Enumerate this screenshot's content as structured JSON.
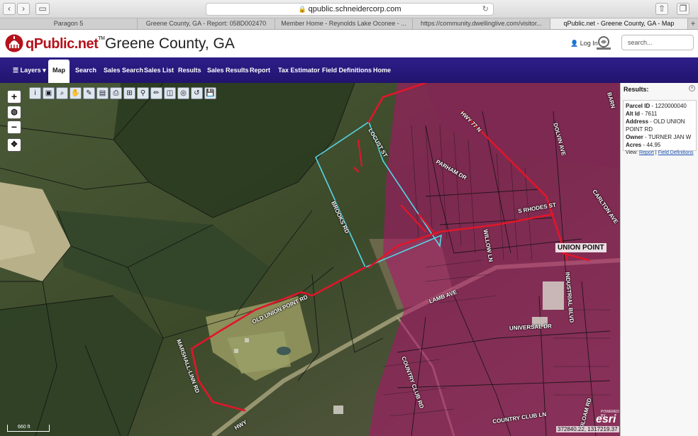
{
  "browser": {
    "url": "qpublic.schneidercorp.com",
    "tabs": [
      {
        "label": "Paragon 5",
        "active": false
      },
      {
        "label": "Greene County, GA - Report: 058D002470",
        "active": false
      },
      {
        "label": "Member Home - Reynolds Lake Oconee - ...",
        "active": false
      },
      {
        "label": "https://community.dwellinglive.com/visitor...",
        "active": false
      },
      {
        "label": "qPublic.net - Greene County, GA - Map",
        "active": true
      }
    ]
  },
  "header": {
    "logo": "qPublic.net",
    "logo_tm": "TM",
    "county": "Greene County, GA",
    "login": "Log In",
    "search_placeholder": "search..."
  },
  "nav": {
    "layers": "Layers",
    "map": "Map",
    "search": "Search",
    "sales_search": "Sales Search",
    "sales_list": "Sales List",
    "results": "Results",
    "sales_results": "Sales Results",
    "report": "Report",
    "tax_estimator": "Tax Estimator",
    "field_definitions": "Field Definitions",
    "home": "Home"
  },
  "map": {
    "scale": "660 ft",
    "coordinates": "372840.22, 1317219.37",
    "esri_powered": "POWERED BY",
    "esri": "esri",
    "city_label": "UNION POINT",
    "roads": {
      "hwy77": "HWY 77 N",
      "dolvin": "DOLVIN AVE",
      "carlton": "CARLTON AVE",
      "rhodes": "S RHODES ST",
      "parham": "PARHAM DR",
      "willow": "WILLOW LN",
      "lamb": "LAMB AVE",
      "universal": "UNIVERSAL DR",
      "industrial": "INDUSTRIAL BLVD",
      "country_club_rd": "COUNTRY CLUB RD",
      "country_club_ln": "COUNTRY CLUB LN",
      "siloam": "SILOAM RD",
      "old_union": "OLD UNION POINT RD",
      "marshall": "MARSHALL-LINN RD",
      "locust": "LOCUST ST",
      "brooks": "BROOKS RD",
      "barn": "BARN",
      "hwy": "HWY"
    }
  },
  "results": {
    "title": "Results:",
    "parcel_id_label": "Parcel ID",
    "parcel_id": "1220000040",
    "alt_id_label": "Alt Id",
    "alt_id": "7611",
    "address_label": "Address",
    "address": "OLD UNION POINT RD",
    "owner_label": "Owner",
    "owner": "TURNER JAN W",
    "acres_label": "Acres",
    "acres": "44.95",
    "view_label": "View:",
    "report_link": "Report",
    "field_definitions_link": "Field Definitions"
  }
}
